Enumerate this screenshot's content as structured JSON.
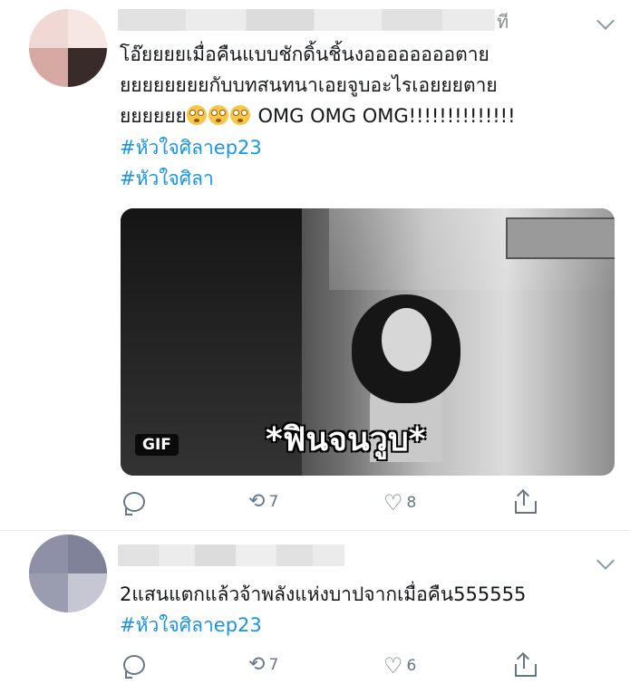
{
  "tweet1": {
    "handle_fragment": "ที",
    "text": "โอ๊ยยยยเมื่อคืนแบบชักดิ้นชิ้นงออออออออตาย\nยยยยยยยยกับบทสนทนาเอยจูบอะไรเอยยยตาย\nยยยยยย",
    "text_suffix": "OMG OMG OMG!!!!!!!!!!!!!!",
    "hashtags": [
      "#หัวใจศิลาep23",
      "#หัวใจศิลา"
    ],
    "media": {
      "badge": "GIF",
      "caption": "*ฟินจนวูบ*"
    },
    "actions": {
      "retweet_count": "7",
      "like_count": "8"
    }
  },
  "tweet2": {
    "text": "2แสนแตกแล้วจ้าพลังแห่งบาปจากเมื่อคืน555555",
    "hashtags": [
      "#หัวใจศิลาep23"
    ],
    "actions": {
      "retweet_count": "7",
      "like_count": "6"
    }
  },
  "icons": {
    "reply": "reply-icon",
    "retweet": "retweet-icon",
    "like": "heart-icon",
    "share": "share-icon",
    "emoji": "flushed-face-emoji"
  },
  "colors": {
    "hashtag": "#1b95e0",
    "icon_gray": "#657786",
    "divider": "#e6ecf0"
  }
}
